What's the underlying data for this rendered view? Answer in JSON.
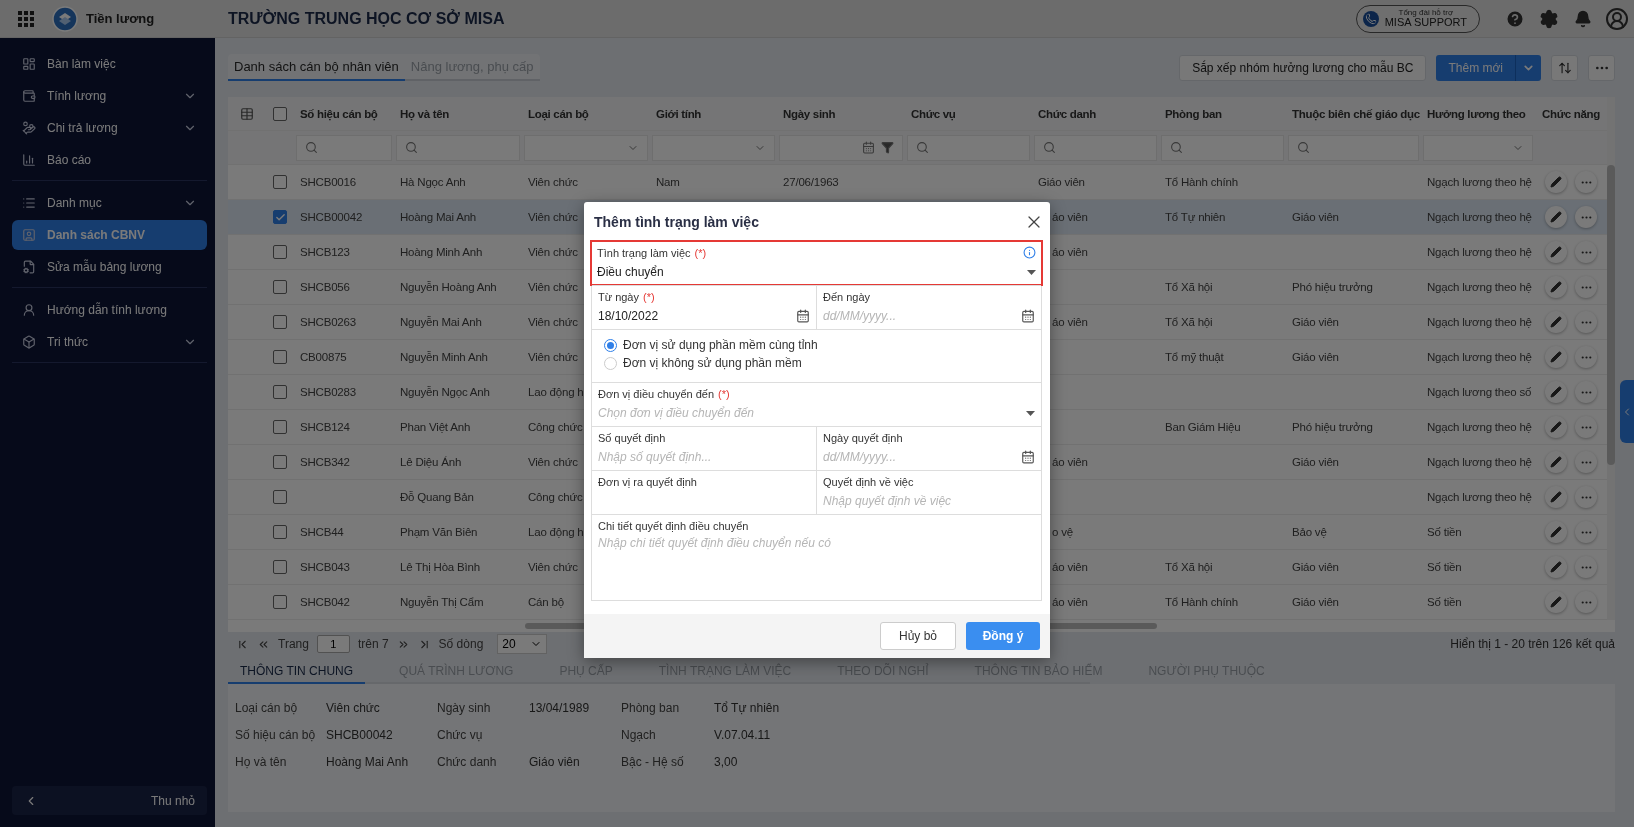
{
  "app": {
    "name": "Tiền lương"
  },
  "school": "TRƯỜNG TRUNG HỌC CƠ SỞ MISA",
  "support": {
    "caption": "Tổng đài hỗ trợ",
    "label": "MISA SUPPORT"
  },
  "sidebar": {
    "groups": [
      {
        "items": [
          {
            "label": "Bàn làm việc",
            "selected": false,
            "has_submenu": false
          },
          {
            "label": "Tính lương",
            "selected": false,
            "has_submenu": true
          },
          {
            "label": "Chi trả lương",
            "selected": false,
            "has_submenu": true
          },
          {
            "label": "Báo cáo",
            "selected": false,
            "has_submenu": false
          }
        ]
      },
      {
        "items": [
          {
            "label": "Danh mục",
            "selected": false,
            "has_submenu": true
          },
          {
            "label": "Danh sách CBNV",
            "selected": true,
            "has_submenu": false
          },
          {
            "label": "Sửa mẫu bảng lương",
            "selected": false,
            "has_submenu": false
          }
        ]
      },
      {
        "items": [
          {
            "label": "Hướng dẫn tính lương",
            "selected": false,
            "has_submenu": false
          },
          {
            "label": "Tri thức",
            "selected": false,
            "has_submenu": true
          }
        ]
      }
    ],
    "collapse_label": "Thu nhỏ"
  },
  "tabs": [
    {
      "label": "Danh sách cán bộ nhân viên",
      "selected": true
    },
    {
      "label": "Nâng lương, phụ cấp",
      "selected": false
    }
  ],
  "toolbar": {
    "sort_button": "Sắp xếp nhóm hưởng lương cho mẫu BC",
    "add_button": "Thêm mới"
  },
  "table": {
    "all_checked": false,
    "columns": [
      {
        "label": "Số hiệu cán bộ",
        "kind": "search"
      },
      {
        "label": "Họ và tên",
        "kind": "search"
      },
      {
        "label": "Loại cán bộ",
        "kind": "select"
      },
      {
        "label": "Giới tính",
        "kind": "select"
      },
      {
        "label": "Ngày sinh",
        "kind": "date"
      },
      {
        "label": "Chức vụ",
        "kind": "search"
      },
      {
        "label": "Chức danh",
        "kind": "search"
      },
      {
        "label": "Phòng ban",
        "kind": "search"
      },
      {
        "label": "Thuộc biên chế giáo dục",
        "kind": "search"
      },
      {
        "label": "Hưởng lương theo",
        "kind": "select"
      }
    ],
    "actions_label": "Chức năng",
    "rows": [
      {
        "checked": false,
        "code": "SHCB0016",
        "name": "Hà Ngọc Anh",
        "type": "Viên chức",
        "gender": "Nam",
        "birth_date": "27/06/1963",
        "title": "Giáo viên",
        "department": "Tổ Hành chính",
        "salary_basis": "Ngạch lương theo hệ"
      },
      {
        "checked": true,
        "code": "SHCB00042",
        "name": "Hoàng Mai Anh",
        "type": "Viên chức",
        "title": "áo viên",
        "department": "Tổ Tự nhiên",
        "staffing": "Giáo viên",
        "salary_basis": "Ngạch lương theo hệ"
      },
      {
        "checked": false,
        "code": "SHCB123",
        "name": "Hoàng Minh Anh",
        "type": "Viên chức",
        "title": "áo viên",
        "salary_basis": "Ngạch lương theo hệ"
      },
      {
        "checked": false,
        "code": "SHCB056",
        "name": "Nguyễn Hoàng Anh",
        "type": "Viên chức",
        "department": "Tổ Xã hội",
        "staffing": "Phó hiệu trưởng",
        "salary_basis": "Ngạch lương theo hệ"
      },
      {
        "checked": false,
        "code": "SHCB0263",
        "name": "Nguyễn Mai Anh",
        "type": "Viên chức",
        "title": "áo viên",
        "department": "Tổ Xã hội",
        "staffing": "Giáo viên",
        "salary_basis": "Ngạch lương theo hệ"
      },
      {
        "checked": false,
        "code": "CB00875",
        "name": "Nguyễn Minh Anh",
        "type": "Viên chức",
        "department": "Tổ mỹ thuật",
        "staffing": "Giáo viên",
        "salary_basis": "Ngạch lương theo hệ"
      },
      {
        "checked": false,
        "code": "SHCB0283",
        "name": "Nguyễn Ngọc Anh",
        "type": "Lao động h",
        "salary_basis": "Ngạch lương theo số"
      },
      {
        "checked": false,
        "code": "SHCB124",
        "name": "Phan Việt Anh",
        "type": "Công chức",
        "department": "Ban Giám Hiệu",
        "staffing": "Phó hiệu trưởng",
        "salary_basis": "Ngạch lương theo hệ"
      },
      {
        "checked": false,
        "code": "SHCB342",
        "name": "Lê Diệu Ánh",
        "type": "Viên chức",
        "title": "áo viên",
        "staffing": "Giáo viên",
        "salary_basis": "Ngạch lương theo hệ"
      },
      {
        "checked": false,
        "name": "Đỗ Quang Bản",
        "type": "Công chức",
        "salary_basis": "Ngạch lương theo hệ"
      },
      {
        "checked": false,
        "code": "SHCB44",
        "name": "Phạm Văn Biên",
        "type": "Lao động h",
        "title": "o vệ",
        "staffing": "Bảo vệ",
        "salary_basis": "Số tiền"
      },
      {
        "checked": false,
        "code": "SHCB043",
        "name": "Lê Thị Hòa Bình",
        "type": "Viên chức",
        "title": "áo viên",
        "department": "Tổ Xã hội",
        "staffing": "Giáo viên",
        "salary_basis": "Số tiền"
      },
      {
        "checked": false,
        "code": "SHCB042",
        "name": "Nguyễn Thị Cẩm",
        "type": "Cán bộ",
        "title": "áo viên",
        "department": "Tổ Hành chính",
        "staffing": "Giáo viên",
        "salary_basis": "Số tiền"
      }
    ]
  },
  "pagination": {
    "page_label": "Trang",
    "page": "1",
    "of_pages": "trên 7",
    "rows_label": "Số dòng",
    "rows_per_page": "20",
    "summary": "Hiển thị 1 - 20 trên 126 kết quả"
  },
  "detail_tabs": [
    {
      "label": "THÔNG TIN CHUNG",
      "selected": true
    },
    {
      "label": "QUÁ TRÌNH LƯƠNG",
      "selected": false
    },
    {
      "label": "PHỤ CẤP",
      "selected": false
    },
    {
      "label": "TÌNH TRẠNG LÀM VIỆC",
      "selected": false
    },
    {
      "label": "THEO DÕI NGHỈ",
      "selected": false
    },
    {
      "label": "THÔNG TIN BẢO HIỂM",
      "selected": false
    },
    {
      "label": "NGƯỜI PHỤ THUỘC",
      "selected": false
    }
  ],
  "details": [
    {
      "label": "Loại cán bộ",
      "value": "Viên chức"
    },
    {
      "label": "Ngày sinh",
      "value": "13/04/1989"
    },
    {
      "label": "Phòng ban",
      "value": "Tổ Tự nhiên"
    },
    {
      "label": "Số hiệu cán bộ",
      "value": "SHCB00042"
    },
    {
      "label": "Chức vụ"
    },
    {
      "label": "Ngạch",
      "value": "V.07.04.11"
    },
    {
      "label": "Họ và tên",
      "value": "Hoàng Mai Anh"
    },
    {
      "label": "Chức danh",
      "value": "Giáo viên"
    },
    {
      "label": "Bậc - Hệ số",
      "value": "3,00"
    }
  ],
  "modal": {
    "title": "Thêm tình trạng làm việc",
    "form_rows": [
      [
        {
          "kind": "select",
          "label": "Tình trạng làm việc",
          "required_mark": "(*)",
          "value": "Điều chuyển",
          "highlighted": true
        }
      ],
      [
        {
          "kind": "date",
          "label": "Từ ngày",
          "required_mark": "(*)",
          "value": "18/10/2022"
        },
        {
          "kind": "date",
          "label": "Đến ngày",
          "placeholder": "dd/MM/yyyy..."
        }
      ],
      [
        {
          "kind": "radios",
          "options": [
            {
              "label": "Đơn vị sử dụng phần mềm cùng tỉnh",
              "selected": true
            },
            {
              "label": "Đơn vị không sử dụng phần mềm",
              "selected": false
            }
          ]
        }
      ],
      [
        {
          "kind": "select",
          "label": "Đơn vị điều chuyển đến",
          "required_mark": "(*)",
          "placeholder": "Chọn đơn vị điều chuyển đến"
        }
      ],
      [
        {
          "kind": "text",
          "label": "Số quyết định",
          "placeholder": "Nhập số quyết định..."
        },
        {
          "kind": "date",
          "label": "Ngày quyết định",
          "placeholder": "dd/MM/yyyy..."
        }
      ],
      [
        {
          "kind": "text",
          "label": "Đơn vị ra quyết định"
        },
        {
          "kind": "text",
          "label": "Quyết định về việc",
          "placeholder": "Nhập quyết định về việc"
        }
      ],
      [
        {
          "kind": "textarea",
          "label": "Chi tiết quyết định điều chuyển",
          "placeholder": "Nhập chi tiết quyết định điều chuyển nếu có"
        }
      ]
    ],
    "cancel": "Hủy bỏ",
    "confirm": "Đồng ý"
  }
}
